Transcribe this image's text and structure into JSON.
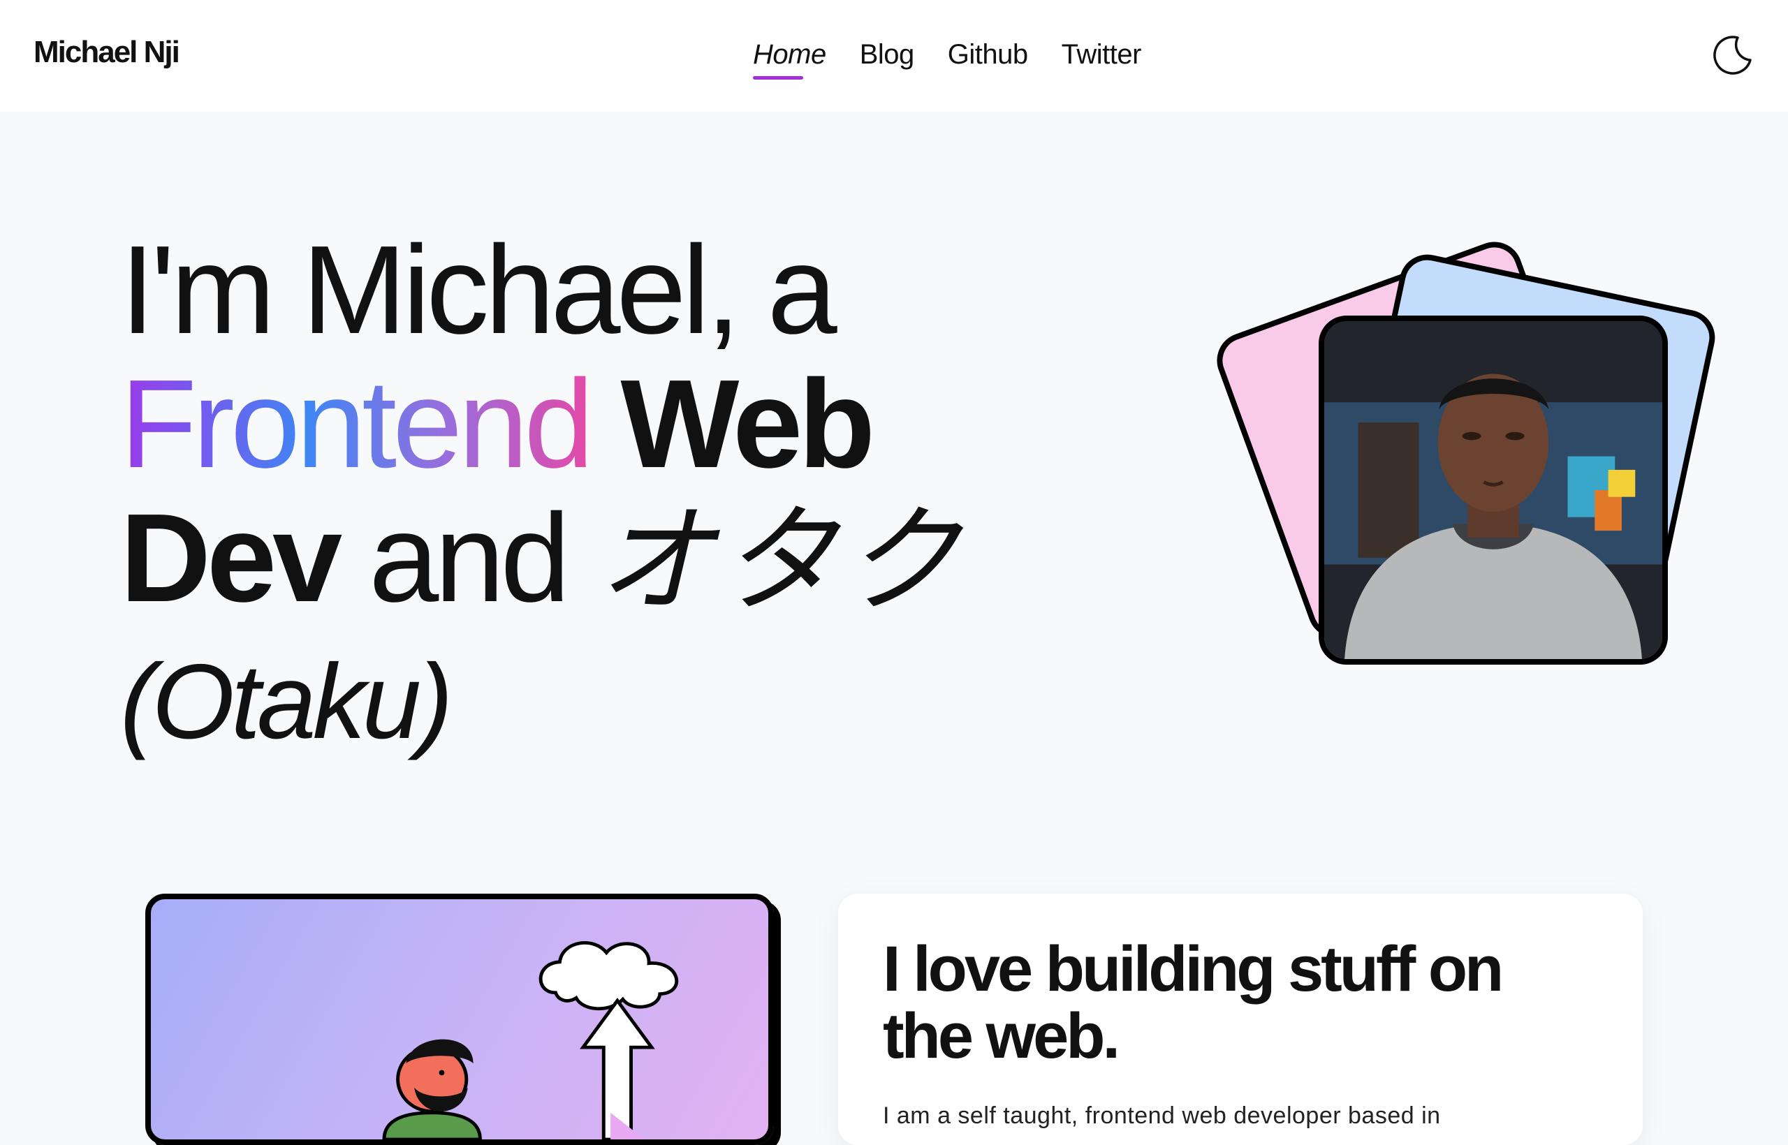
{
  "header": {
    "brand": "Michael Nji",
    "nav": [
      {
        "label": "Home",
        "active": true
      },
      {
        "label": "Blog",
        "active": false
      },
      {
        "label": "Github",
        "active": false
      },
      {
        "label": "Twitter",
        "active": false
      }
    ],
    "theme_icon": "moon-icon"
  },
  "hero": {
    "line1": "I'm Michael, a",
    "frontend": "Frontend",
    "web": "Web",
    "dev": "Dev",
    "and": "and",
    "otaku_jp": "オタク",
    "otaku_en": "(Otaku)"
  },
  "photo": {
    "card_colors": {
      "pink": "#f9cbe8",
      "blue": "#c4dcfb"
    }
  },
  "intro": {
    "title": "I love building stuff on the web.",
    "body": "I am a self taught, frontend web developer based in"
  },
  "colors": {
    "accent": "#a42fd8",
    "gradient": [
      "#9b3bea",
      "#3f86f4",
      "#e44aa7"
    ]
  }
}
